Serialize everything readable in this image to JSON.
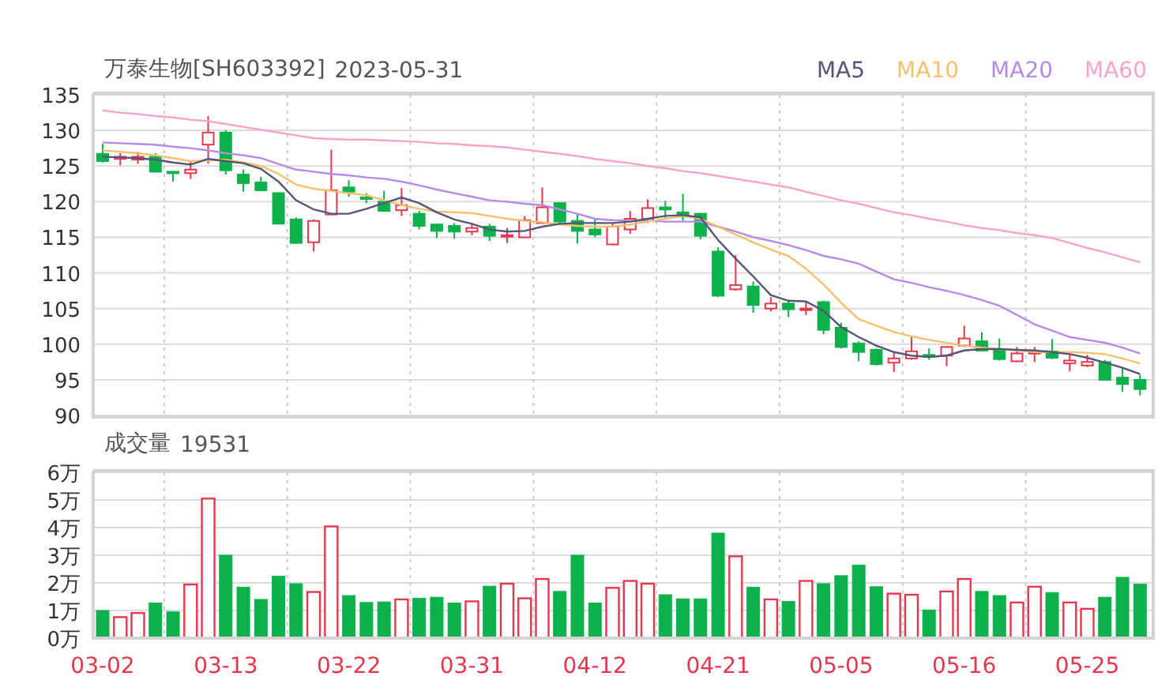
{
  "price": {
    "title": "万泰生物[SH603392]",
    "date": "2023-05-31",
    "chart_data": {
      "type": "candlestick",
      "grid": true,
      "ylim": [
        90,
        135
      ],
      "yticks": [
        90,
        95,
        100,
        105,
        110,
        115,
        120,
        125,
        130,
        135
      ],
      "series": [
        {
          "name": "MA5",
          "type": "line",
          "color": "#555577",
          "values": [
            126.3,
            126.2,
            126.1,
            125.9,
            125.5,
            125.2,
            126.0,
            125.7,
            125.4,
            124.6,
            122.8,
            120.2,
            118.9,
            118.3,
            118.3,
            119.0,
            119.8,
            120.6,
            119.8,
            118.5,
            117.5,
            116.9,
            116.1,
            115.8,
            115.9,
            116.5,
            116.9,
            117.0,
            117.0,
            117.0,
            117.2,
            117.6,
            118.0,
            118.1,
            117.8,
            114.6,
            112.0,
            109.5,
            106.9,
            106.1,
            106.0,
            104.7,
            102.4,
            101.0,
            99.8,
            98.9,
            98.4,
            98.2,
            98.4,
            99.1,
            99.3,
            99.3,
            99.2,
            99.1,
            98.9,
            98.6,
            98.1,
            97.4,
            96.7,
            95.8
          ]
        },
        {
          "name": "MA10",
          "type": "line",
          "color": "#f5c26b",
          "values": [
            127.2,
            127.0,
            126.8,
            126.5,
            126.1,
            125.7,
            125.8,
            125.9,
            125.5,
            125.0,
            123.9,
            122.4,
            121.8,
            121.5,
            121.2,
            120.9,
            120.2,
            119.5,
            119.0,
            118.6,
            118.5,
            118.4,
            118.0,
            117.6,
            117.3,
            117.1,
            116.8,
            116.6,
            116.5,
            116.5,
            116.8,
            117.2,
            117.6,
            118.0,
            117.6,
            116.5,
            115.4,
            114.3,
            113.3,
            112.4,
            110.6,
            108.4,
            105.8,
            103.5,
            102.6,
            101.7,
            101.1,
            100.6,
            100.2,
            99.8,
            99.5,
            99.3,
            99.1,
            98.9,
            98.9,
            98.9,
            98.8,
            98.6,
            98.0,
            97.3
          ]
        },
        {
          "name": "MA20",
          "type": "line",
          "color": "#b48be6",
          "values": [
            128.3,
            128.2,
            128.1,
            128.0,
            127.7,
            127.5,
            127.2,
            126.8,
            126.5,
            126.1,
            125.3,
            124.5,
            124.2,
            123.9,
            123.7,
            123.4,
            123.2,
            122.8,
            122.3,
            121.7,
            121.2,
            120.7,
            120.2,
            120.0,
            119.7,
            119.5,
            118.9,
            118.3,
            117.6,
            117.4,
            117.3,
            117.3,
            117.2,
            117.2,
            117.2,
            116.5,
            115.8,
            115.0,
            114.5,
            113.9,
            113.2,
            112.4,
            111.9,
            111.3,
            110.2,
            109.1,
            108.6,
            108.0,
            107.5,
            106.9,
            106.2,
            105.4,
            104.1,
            102.8,
            101.9,
            101.0,
            100.6,
            100.2,
            99.5,
            98.7
          ]
        },
        {
          "name": "MA60",
          "type": "line",
          "color": "#f7a3cc",
          "values": [
            132.8,
            132.5,
            132.3,
            132.0,
            131.8,
            131.5,
            131.3,
            130.9,
            130.5,
            130.1,
            129.7,
            129.3,
            128.9,
            128.8,
            128.7,
            128.7,
            128.6,
            128.5,
            128.4,
            128.2,
            128.1,
            127.9,
            127.8,
            127.6,
            127.3,
            127.0,
            126.7,
            126.4,
            126.0,
            125.7,
            125.4,
            125.0,
            124.7,
            124.3,
            124.0,
            123.6,
            123.2,
            122.8,
            122.4,
            122.0,
            121.4,
            120.8,
            120.2,
            119.7,
            119.1,
            118.5,
            118.1,
            117.6,
            117.2,
            116.7,
            116.3,
            116.0,
            115.6,
            115.3,
            114.9,
            114.2,
            113.5,
            112.9,
            112.2,
            111.5
          ]
        }
      ],
      "ohlc": [
        [
          126.7,
          128.1,
          125.5,
          125.7
        ],
        [
          126.0,
          126.8,
          125.1,
          126.3
        ],
        [
          125.9,
          127.0,
          125.3,
          126.3
        ],
        [
          126.3,
          126.8,
          124.2,
          124.2
        ],
        [
          124.2,
          124.3,
          122.8,
          124.0
        ],
        [
          124.0,
          125.8,
          123.2,
          124.5
        ],
        [
          128.0,
          132.0,
          125.3,
          129.7
        ],
        [
          129.7,
          130.0,
          123.8,
          124.4
        ],
        [
          123.8,
          124.5,
          121.4,
          122.6
        ],
        [
          122.7,
          123.5,
          121.5,
          121.6
        ],
        [
          121.2,
          121.3,
          116.9,
          116.9
        ],
        [
          117.5,
          117.8,
          114.2,
          114.2
        ],
        [
          114.3,
          117.5,
          113.0,
          117.3
        ],
        [
          118.2,
          127.3,
          118.2,
          121.6
        ],
        [
          122.0,
          123.0,
          120.7,
          121.4
        ],
        [
          120.6,
          121.2,
          119.8,
          120.5
        ],
        [
          120.0,
          121.5,
          118.7,
          118.7
        ],
        [
          118.8,
          121.9,
          118.0,
          119.5
        ],
        [
          118.3,
          118.7,
          116.1,
          116.6
        ],
        [
          116.8,
          116.9,
          114.9,
          115.9
        ],
        [
          116.6,
          117.0,
          114.8,
          115.8
        ],
        [
          115.8,
          116.9,
          115.3,
          116.3
        ],
        [
          116.5,
          116.9,
          114.5,
          115.2
        ],
        [
          115.1,
          116.3,
          114.2,
          115.3
        ],
        [
          115.0,
          118.0,
          115.0,
          117.4
        ],
        [
          117.0,
          122.0,
          117.0,
          119.2
        ],
        [
          119.8,
          119.9,
          116.7,
          117.2
        ],
        [
          117.3,
          118.2,
          114.1,
          115.9
        ],
        [
          116.1,
          117.5,
          115.0,
          115.4
        ],
        [
          114.0,
          117.0,
          113.9,
          116.5
        ],
        [
          116.1,
          118.7,
          115.5,
          117.6
        ],
        [
          117.6,
          120.3,
          117.0,
          119.1
        ],
        [
          119.2,
          120.1,
          117.6,
          118.9
        ],
        [
          118.5,
          121.1,
          117.3,
          117.9
        ],
        [
          118.3,
          118.4,
          114.7,
          115.2
        ],
        [
          113.0,
          113.6,
          106.6,
          106.8
        ],
        [
          107.7,
          112.5,
          107.5,
          108.3
        ],
        [
          108.1,
          108.8,
          104.4,
          105.5
        ],
        [
          105.0,
          106.6,
          104.6,
          105.7
        ],
        [
          105.7,
          106.1,
          103.8,
          104.9
        ],
        [
          104.8,
          106.0,
          104.1,
          105.0
        ],
        [
          105.9,
          106.1,
          101.4,
          102.0
        ],
        [
          102.3,
          103.0,
          99.4,
          99.6
        ],
        [
          100.1,
          100.4,
          97.6,
          98.9
        ],
        [
          99.2,
          99.4,
          97.0,
          97.2
        ],
        [
          97.4,
          98.8,
          96.1,
          98.0
        ],
        [
          98.0,
          101.0,
          97.8,
          99.0
        ],
        [
          98.5,
          99.4,
          97.8,
          98.3
        ],
        [
          98.4,
          99.7,
          96.9,
          99.6
        ],
        [
          99.8,
          102.6,
          99.6,
          100.8
        ],
        [
          100.4,
          101.7,
          99.0,
          99.1
        ],
        [
          99.3,
          100.8,
          97.7,
          97.9
        ],
        [
          97.6,
          99.6,
          97.5,
          98.7
        ],
        [
          98.8,
          99.6,
          97.5,
          98.9
        ],
        [
          99.0,
          100.7,
          97.9,
          98.1
        ],
        [
          97.3,
          98.5,
          96.2,
          97.7
        ],
        [
          97.0,
          98.5,
          96.8,
          97.5
        ],
        [
          97.5,
          97.8,
          94.9,
          95.0
        ],
        [
          95.3,
          96.6,
          93.3,
          94.4
        ],
        [
          95.0,
          95.7,
          92.8,
          93.7
        ]
      ]
    }
  },
  "volume": {
    "title": "成交量",
    "reading": "19531",
    "chart_data": {
      "type": "bar",
      "grid": true,
      "ylim": [
        0,
        6
      ],
      "categories": [
        "03-02",
        null,
        null,
        null,
        null,
        null,
        null,
        "03-13",
        null,
        null,
        null,
        null,
        null,
        null,
        "03-22",
        null,
        null,
        null,
        null,
        null,
        null,
        "03-31",
        null,
        null,
        null,
        null,
        null,
        null,
        "04-12",
        null,
        null,
        null,
        null,
        null,
        null,
        "04-21",
        null,
        null,
        null,
        null,
        null,
        null,
        "05-05",
        null,
        null,
        null,
        null,
        null,
        null,
        "05-16",
        null,
        null,
        null,
        null,
        null,
        null,
        "05-25",
        null,
        null,
        null
      ],
      "yticks": [
        {
          "value": 0,
          "label": "0万"
        },
        {
          "value": 1,
          "label": "1万"
        },
        {
          "value": 2,
          "label": "2万"
        },
        {
          "value": 3,
          "label": "3万"
        },
        {
          "value": 4,
          "label": "4万"
        },
        {
          "value": 5,
          "label": "5万"
        },
        {
          "value": 6,
          "label": "6万"
        }
      ],
      "values": [
        1.0,
        0.76,
        0.91,
        1.27,
        0.95,
        1.94,
        5.05,
        3.0,
        1.84,
        1.4,
        2.24,
        1.97,
        1.67,
        4.04,
        1.54,
        1.29,
        1.31,
        1.4,
        1.44,
        1.48,
        1.27,
        1.33,
        1.88,
        1.97,
        1.44,
        2.14,
        1.69,
        3.0,
        1.27,
        1.82,
        2.07,
        1.97,
        1.57,
        1.42,
        1.42,
        3.8,
        2.96,
        1.84,
        1.4,
        1.33,
        2.07,
        1.97,
        2.26,
        2.64,
        1.86,
        1.61,
        1.57,
        1.02,
        1.69,
        2.14,
        1.69,
        1.54,
        1.29,
        1.86,
        1.65,
        1.29,
        1.06,
        1.48,
        2.2,
        1.95
      ]
    }
  }
}
